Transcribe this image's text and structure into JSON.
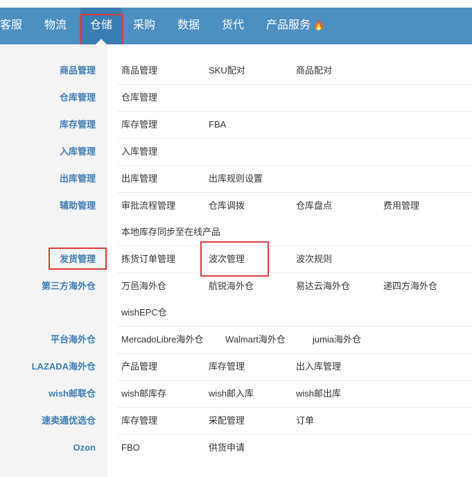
{
  "nav": {
    "items": [
      "客服",
      "物流",
      "仓储",
      "采购",
      "数据",
      "货代",
      "产品服务"
    ],
    "active": "仓储",
    "hot_icon": "flame-icon"
  },
  "menu": {
    "rows": [
      {
        "category": "商品管理",
        "links": [
          "商品管理",
          "SKU配对",
          "商品配对"
        ]
      },
      {
        "category": "仓库管理",
        "links": [
          "仓库管理"
        ]
      },
      {
        "category": "库存管理",
        "links": [
          "库存管理",
          "FBA"
        ]
      },
      {
        "category": "入库管理",
        "links": [
          "入库管理"
        ]
      },
      {
        "category": "出库管理",
        "links": [
          "出库管理",
          "出库规则设置"
        ]
      },
      {
        "category": "辅助管理",
        "links": [
          "审批流程管理",
          "仓库调拨",
          "仓库盘点",
          "费用管理",
          "本地库存同步至在线产品"
        ]
      },
      {
        "category": "发货管理",
        "links": [
          "拣货订单管理",
          "波次管理",
          "波次规则"
        ]
      },
      {
        "category": "第三方海外仓",
        "links": [
          "万邑海外仓",
          "航锐海外仓",
          "易达云海外仓",
          "递四方海外仓",
          "wishEPC仓"
        ]
      },
      {
        "category": "平台海外仓",
        "links": [
          "MercadoLibre海外仓",
          "Walmart海外仓",
          "jumia海外仓"
        ]
      },
      {
        "category": "LAZADA海外仓",
        "links": [
          "产品管理",
          "库存管理",
          "出入库管理"
        ]
      },
      {
        "category": "wish邮联仓",
        "links": [
          "wish邮库存",
          "wish邮入库",
          "wish邮出库"
        ]
      },
      {
        "category": "速卖通优选仓",
        "links": [
          "库存管理",
          "采配管理",
          "订单"
        ]
      },
      {
        "category": "Ozon",
        "links": [
          "FBO",
          "供货申请"
        ]
      }
    ]
  },
  "colors": {
    "nav_bg": "#4d8fc0",
    "category_text": "#3d7cb4",
    "highlight_box": "#e23a3a"
  }
}
